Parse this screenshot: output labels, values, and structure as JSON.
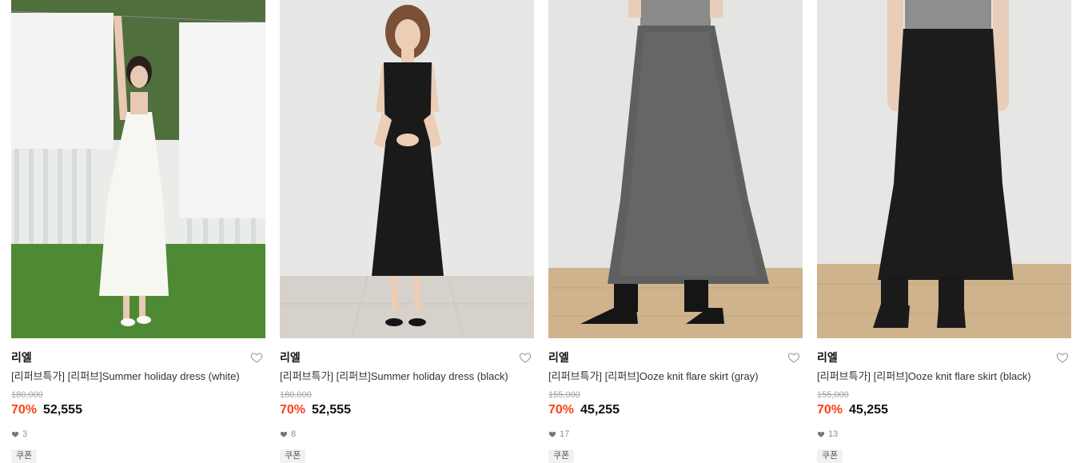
{
  "products": [
    {
      "brand": "리엘",
      "name": "[리퍼브특가] [리퍼브]Summer holiday dress (white)",
      "original_price": "180,000",
      "discount": "70%",
      "price": "52,555",
      "likes": "3",
      "badge": "쿠폰",
      "image_icon": "dress-white-photo"
    },
    {
      "brand": "리엘",
      "name": "[리퍼브특가] [리퍼브]Summer holiday dress (black)",
      "original_price": "180,000",
      "discount": "70%",
      "price": "52,555",
      "likes": "8",
      "badge": "쿠폰",
      "image_icon": "dress-black-photo"
    },
    {
      "brand": "리엘",
      "name": "[리퍼브특가] [리퍼브]Ooze knit flare skirt (gray)",
      "original_price": "155,000",
      "discount": "70%",
      "price": "45,255",
      "likes": "17",
      "badge": "쿠폰",
      "image_icon": "skirt-gray-photo"
    },
    {
      "brand": "리엘",
      "name": "[리퍼브특가] [리퍼브]Ooze knit flare skirt (black)",
      "original_price": "155,000",
      "discount": "70%",
      "price": "45,255",
      "likes": "13",
      "badge": "쿠폰",
      "image_icon": "skirt-black-photo"
    }
  ],
  "colors": {
    "discount": "#ff3f11",
    "brand_text": "#111111",
    "muted_text": "#a3a3a3"
  }
}
